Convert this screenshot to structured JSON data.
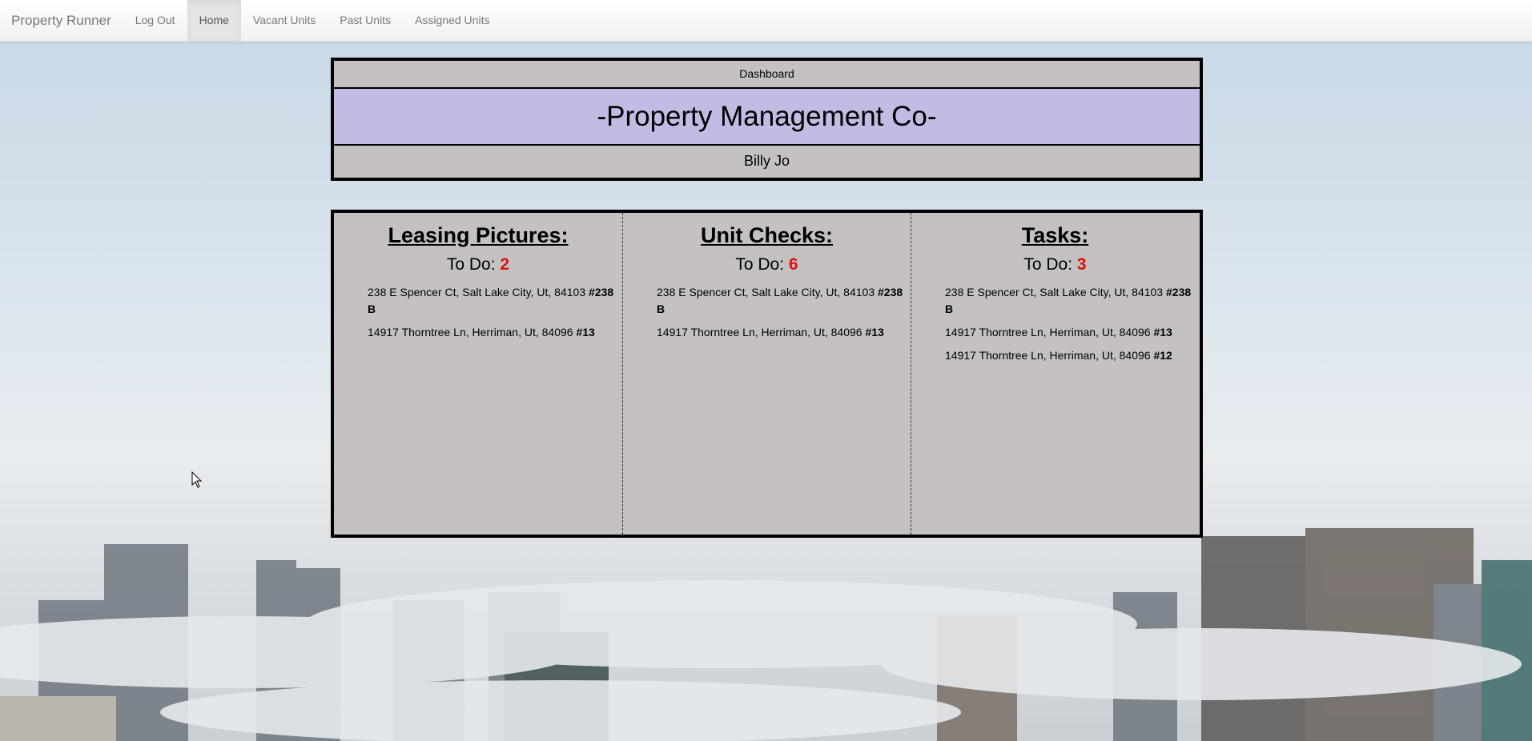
{
  "navbar": {
    "brand": "Property Runner",
    "items": [
      {
        "label": "Log Out"
      },
      {
        "label": "Home",
        "active": true
      },
      {
        "label": "Vacant Units"
      },
      {
        "label": "Past Units"
      },
      {
        "label": "Assigned Units"
      }
    ]
  },
  "header": {
    "section": "Dashboard",
    "company": "-Property Management Co-",
    "user": "Billy Jo"
  },
  "panels": [
    {
      "title": "Leasing Pictures:",
      "todo_label": "To Do:",
      "todo_count": "2",
      "items": [
        {
          "address": "238 E Spencer Ct, Salt Lake City, Ut, 84103",
          "unit": "#238 B"
        },
        {
          "address": "14917 Thorntree Ln, Herriman, Ut, 84096",
          "unit": "#13"
        }
      ]
    },
    {
      "title": "Unit Checks:",
      "todo_label": "To Do:",
      "todo_count": "6",
      "items": [
        {
          "address": "238 E Spencer Ct, Salt Lake City, Ut, 84103",
          "unit": "#238 B"
        },
        {
          "address": "14917 Thorntree Ln, Herriman, Ut, 84096",
          "unit": "#13"
        }
      ]
    },
    {
      "title": "Tasks:",
      "todo_label": "To Do:",
      "todo_count": "3",
      "items": [
        {
          "address": "238 E Spencer Ct, Salt Lake City, Ut, 84103",
          "unit": "#238 B"
        },
        {
          "address": "14917 Thorntree Ln, Herriman, Ut, 84096",
          "unit": "#13"
        },
        {
          "address": "14917 Thorntree Ln, Herriman, Ut, 84096",
          "unit": "#12"
        }
      ]
    }
  ],
  "colors": {
    "header_title_bg": "#c3bbe3",
    "panel_bg": "#c5c1c1",
    "count_color": "#dd1111"
  }
}
